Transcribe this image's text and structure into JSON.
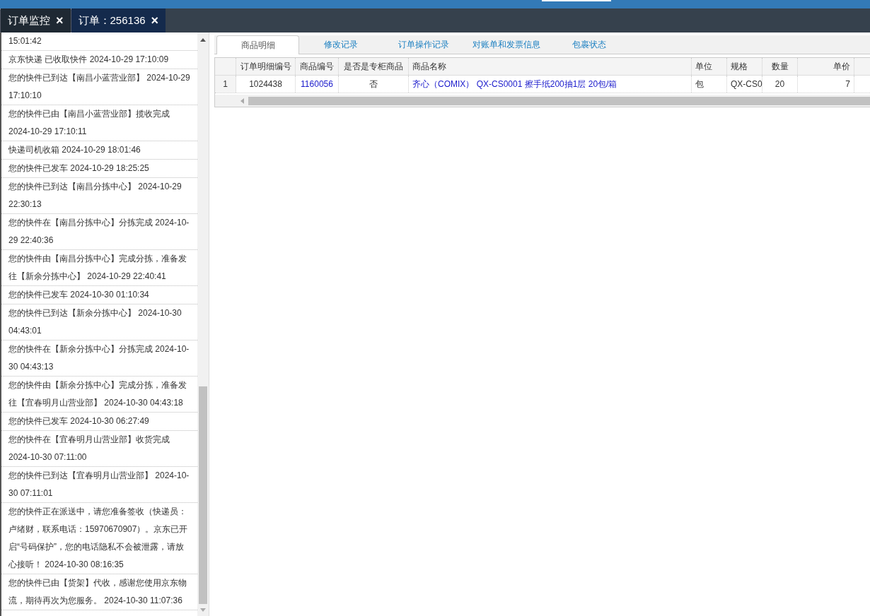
{
  "main_tabs": [
    {
      "label": "订单监控",
      "close": "×",
      "selected": false
    },
    {
      "label": "订单：256136",
      "close": "×",
      "selected": true
    }
  ],
  "tracking_log": [
    "15:01:42",
    "京东快递 已收取快件 2024-10-29 17:10:09",
    "您的快件已到达【南昌小蓝营业部】 2024-10-29 17:10:10",
    "您的快件已由【南昌小蓝营业部】揽收完成 2024-10-29 17:10:11",
    "快递司机收箱 2024-10-29 18:01:46",
    "您的快件已发车 2024-10-29 18:25:25",
    "您的快件已到达【南昌分拣中心】 2024-10-29 22:30:13",
    "您的快件在【南昌分拣中心】分拣完成 2024-10-29 22:40:36",
    "您的快件由【南昌分拣中心】完成分拣，准备发往【新余分拣中心】 2024-10-29 22:40:41",
    "您的快件已发车 2024-10-30 01:10:34",
    "您的快件已到达【新余分拣中心】 2024-10-30 04:43:01",
    "您的快件在【新余分拣中心】分拣完成 2024-10-30 04:43:13",
    "您的快件由【新余分拣中心】完成分拣，准备发往【宜春明月山营业部】 2024-10-30 04:43:18",
    "您的快件已发车 2024-10-30 06:27:49",
    "您的快件在【宜春明月山营业部】收货完成 2024-10-30 07:11:00",
    "您的快件已到达【宜春明月山营业部】 2024-10-30 07:11:01",
    "您的快件正在派送中，请您准备签收（快递员：卢绪财，联系电话：15970670907）。京东已开启“号码保护”，您的电话隐私不会被泄露，请放心接听！ 2024-10-30 08:16:35",
    "您的快件已由【货架】代收，感谢您使用京东物流，期待再次为您服务。 2024-10-30 11:07:36"
  ],
  "detail_tabs": [
    {
      "label": "商品明细",
      "selected": true
    },
    {
      "label": "修改记录",
      "selected": false
    },
    {
      "label": "订单操作记录",
      "selected": false
    },
    {
      "label": "对账单和发票信息",
      "selected": false
    },
    {
      "label": "包裹状态",
      "selected": false
    }
  ],
  "table": {
    "columns": [
      "订单明细编号",
      "商品编号",
      "是否是专柜商品",
      "商品名称",
      "单位",
      "规格",
      "数量",
      "单价"
    ],
    "rows": [
      {
        "row_number": "1",
        "cells": [
          "1024438",
          "1160056",
          "否",
          "齐心（COMIX） QX-CS0001 擦手纸200抽1层 20包/箱",
          "包",
          "QX-CS0",
          "20",
          "7"
        ]
      }
    ]
  }
}
